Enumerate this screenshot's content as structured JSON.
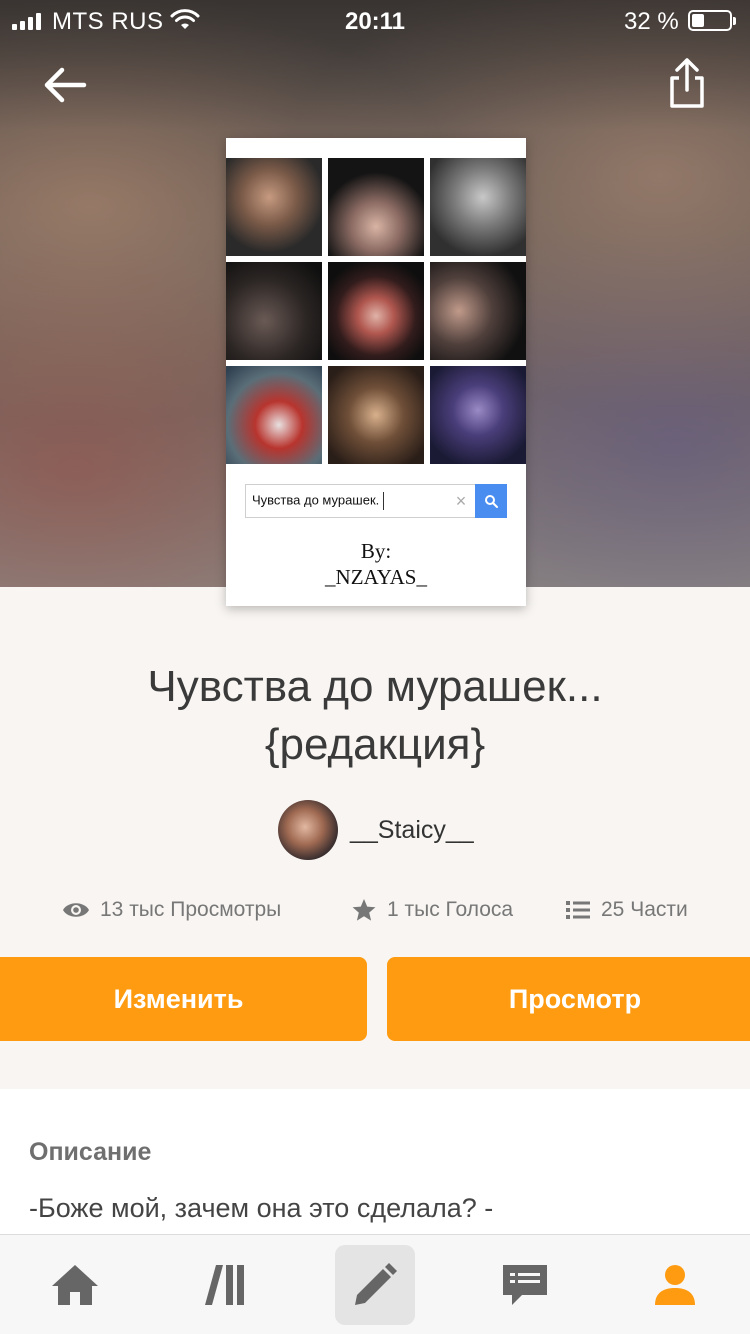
{
  "status_bar": {
    "carrier": "MTS RUS",
    "time": "20:11",
    "battery": "32 %"
  },
  "cover": {
    "search_text": "Чувства до мурашек.",
    "by_label": "By:",
    "author_tag": "_NZAYAS_"
  },
  "story": {
    "title_line1": "Чувства до мурашек...",
    "title_line2": "{редакция}",
    "author": "__Staicy__"
  },
  "stats": {
    "views": "13 тыс Просмотры",
    "votes": "1 тыс Голоса",
    "parts": "25 Части"
  },
  "actions": {
    "edit_label": "Изменить",
    "view_label": "Просмотр"
  },
  "description": {
    "heading": "Описание",
    "text": "-Боже мой, зачем она это сделала? -"
  },
  "tab_bar": {
    "active_color": "#ff9b10",
    "inactive_color": "#666666",
    "items": [
      "home-icon",
      "library-icon",
      "pencil-icon",
      "messages-icon",
      "profile-icon"
    ]
  },
  "colors": {
    "accent": "#ff9b10",
    "background": "#f8f5f2"
  }
}
